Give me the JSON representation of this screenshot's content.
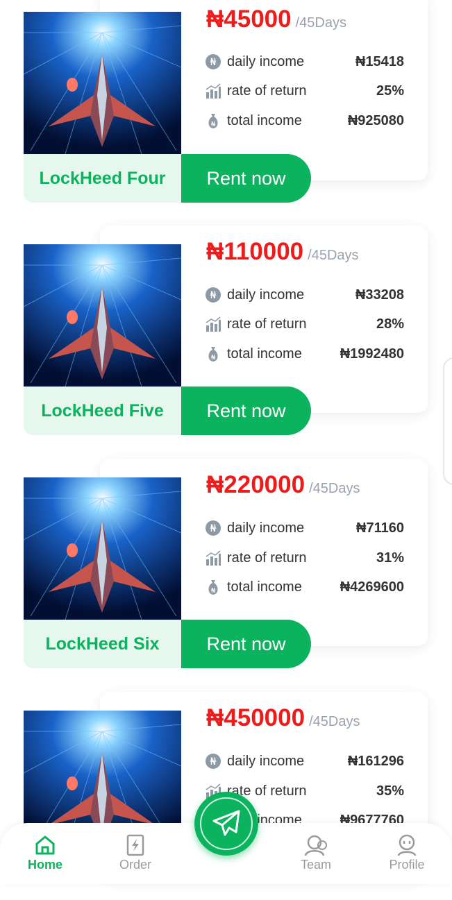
{
  "currency_symbol": "₦",
  "period_label": "/45Days",
  "labels": {
    "daily_income": "daily income",
    "rate_of_return": "rate of return",
    "total_income": "total income",
    "rent_button": "Rent now"
  },
  "products": [
    {
      "name": "LockHeed Four",
      "price": "₦45000",
      "daily_income": "₦15418",
      "rate_of_return": "25%",
      "total_income": "₦925080"
    },
    {
      "name": "LockHeed Five",
      "price": "₦110000",
      "daily_income": "₦33208",
      "rate_of_return": "28%",
      "total_income": "₦1992480"
    },
    {
      "name": "LockHeed Six",
      "price": "₦220000",
      "daily_income": "₦71160",
      "rate_of_return": "31%",
      "total_income": "₦4269600"
    },
    {
      "name": "",
      "price": "₦450000",
      "daily_income": "₦161296",
      "rate_of_return": "35%",
      "total_income": "₦9677760"
    }
  ],
  "nav": {
    "home": "Home",
    "order": "Order",
    "team": "Team",
    "profile": "Profile",
    "active": "home"
  },
  "colors": {
    "accent": "#0bb35f",
    "price": "#ee1b1b",
    "name_bg": "#e6f7ee"
  }
}
